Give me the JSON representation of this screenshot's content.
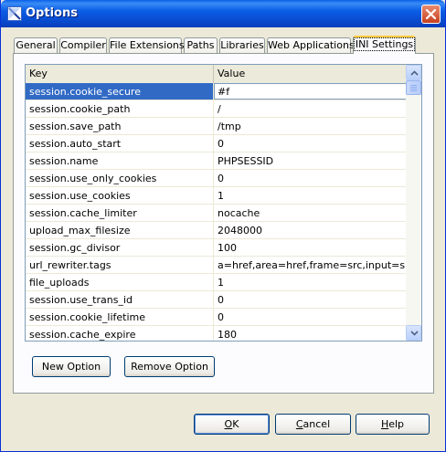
{
  "window": {
    "title": "Options"
  },
  "tabs": [
    {
      "label": "General",
      "active": false
    },
    {
      "label": "Compiler",
      "active": false
    },
    {
      "label": "File Extensions",
      "active": false
    },
    {
      "label": "Paths",
      "active": false
    },
    {
      "label": "Libraries",
      "active": false
    },
    {
      "label": "Web Applications",
      "active": false
    },
    {
      "label": "INI Settings",
      "active": true
    }
  ],
  "grid": {
    "columns": {
      "key": "Key",
      "value": "Value"
    },
    "rows": [
      {
        "key": "session.cookie_secure",
        "value": "#f"
      },
      {
        "key": "session.cookie_path",
        "value": "/"
      },
      {
        "key": "session.save_path",
        "value": "/tmp"
      },
      {
        "key": "session.auto_start",
        "value": "0"
      },
      {
        "key": "session.name",
        "value": "PHPSESSID"
      },
      {
        "key": "session.use_only_cookies",
        "value": "0"
      },
      {
        "key": "session.use_cookies",
        "value": "1"
      },
      {
        "key": "session.cache_limiter",
        "value": "nocache"
      },
      {
        "key": "upload_max_filesize",
        "value": "2048000"
      },
      {
        "key": "session.gc_divisor",
        "value": "100"
      },
      {
        "key": "url_rewriter.tags",
        "value": "a=href,area=href,frame=src,input=src,form="
      },
      {
        "key": "file_uploads",
        "value": "1"
      },
      {
        "key": "session.use_trans_id",
        "value": "0"
      },
      {
        "key": "session.cookie_lifetime",
        "value": "0"
      },
      {
        "key": "session.cache_expire",
        "value": "180"
      }
    ]
  },
  "panel_buttons": {
    "new_option": "New Option",
    "remove_option": "Remove Option"
  },
  "dialog_buttons": {
    "ok_key": "O",
    "ok_rest": "K",
    "cancel_key": "C",
    "cancel_rest": "ancel",
    "help_key": "H",
    "help_rest": "elp"
  },
  "colors": {
    "selection": "#316AC5",
    "titlebar": "#0A5FE8",
    "active_tab_accent": "#FFC83C",
    "dialog_bg": "#ECE9D8"
  }
}
